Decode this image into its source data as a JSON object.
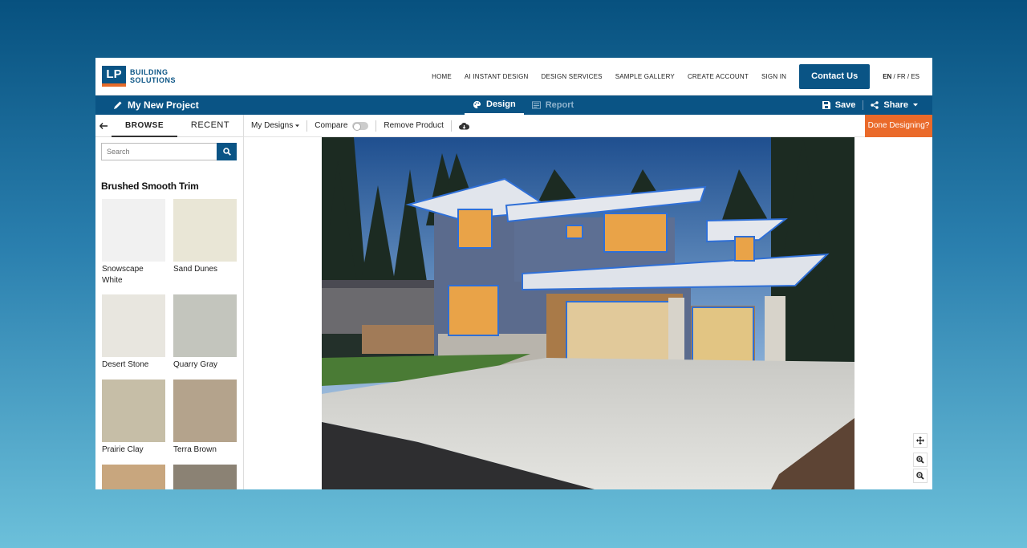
{
  "header": {
    "logo_mark": "LP",
    "logo_line1": "BUILDING",
    "logo_line2": "SOLUTIONS",
    "nav": [
      "HOME",
      "AI INSTANT DESIGN",
      "DESIGN SERVICES",
      "SAMPLE GALLERY",
      "CREATE ACCOUNT",
      "SIGN IN"
    ],
    "contact_label": "Contact Us",
    "lang_active": "EN",
    "lang_rest": " / FR / ES"
  },
  "project": {
    "title": "My New Project",
    "tab_design": "Design",
    "tab_report": "Report",
    "save_label": "Save",
    "share_label": "Share"
  },
  "sidebar": {
    "tab_browse": "BROWSE",
    "tab_recent": "RECENT",
    "search_placeholder": "Search",
    "section_title": "Brushed Smooth Trim",
    "swatches": [
      {
        "name": "Snowscape White",
        "color": "#f1f1f1"
      },
      {
        "name": "Sand Dunes",
        "color": "#e9e6d6"
      },
      {
        "name": "Desert Stone",
        "color": "#e8e6df"
      },
      {
        "name": "Quarry Gray",
        "color": "#c3c5bd"
      },
      {
        "name": "Prairie Clay",
        "color": "#c6bea7"
      },
      {
        "name": "Terra Brown",
        "color": "#b4a38c"
      },
      {
        "name": "",
        "color": "#c8a67e"
      },
      {
        "name": "",
        "color": "#8b8274"
      }
    ]
  },
  "toolbar": {
    "my_designs": "My Designs",
    "compare": "Compare",
    "remove_product": "Remove Product",
    "done_label": "Done Designing?"
  },
  "colors": {
    "brand_blue": "#0a5485",
    "accent_orange": "#ea6a2a",
    "outline_blue": "#2f6fd6"
  },
  "icons": [
    "pencil-icon",
    "palette-icon",
    "report-icon",
    "save-icon",
    "share-icon",
    "back-arrow-icon",
    "search-icon",
    "cloud-download-icon",
    "move-icon",
    "zoom-in-icon",
    "zoom-out-icon"
  ]
}
